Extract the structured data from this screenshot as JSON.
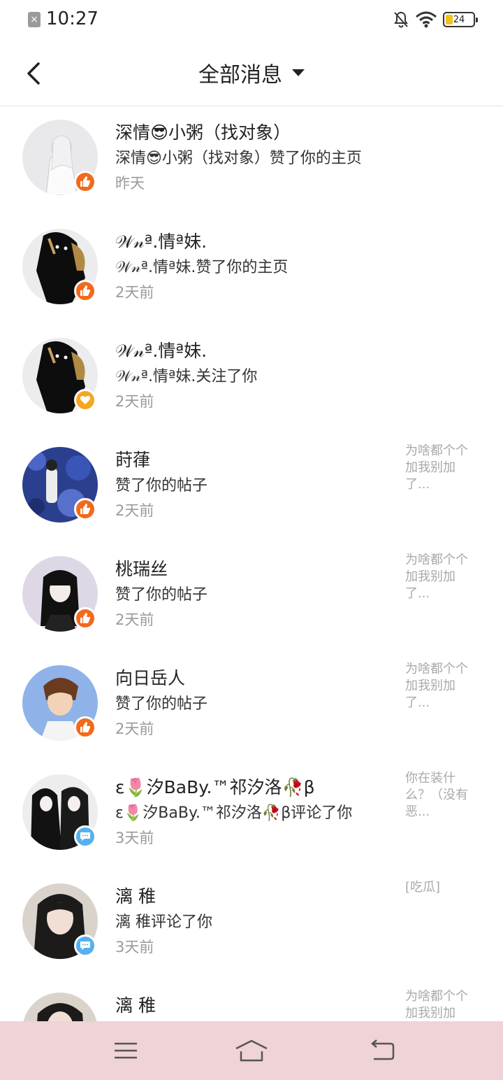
{
  "status_bar": {
    "time": "10:27",
    "battery_level": "24",
    "battery_fraction": 0.24,
    "icons": [
      "notification-icon",
      "mute-icon",
      "wifi-icon",
      "battery-icon"
    ]
  },
  "header": {
    "title": "全部消息"
  },
  "colors": {
    "like_badge": "#f26a1b",
    "follow_badge": "#f5a623",
    "comment_badge": "#56b0f0",
    "nav_bar": "#efd3d6"
  },
  "messages": [
    {
      "name": "深情😎小粥（找对象）",
      "action": "深情😎小粥（找对象）赞了你的主页",
      "time": "昨天",
      "preview": "",
      "badge": "like-icon"
    },
    {
      "name": "𝒲𝓃ª.情ª妹.",
      "action": "𝒲𝓃ª.情ª妹.赞了你的主页",
      "time": "2天前",
      "preview": "",
      "badge": "like-icon"
    },
    {
      "name": "𝒲𝓃ª.情ª妹.",
      "action": "𝒲𝓃ª.情ª妹.关注了你",
      "time": "2天前",
      "preview": "",
      "badge": "heart-icon"
    },
    {
      "name": "莳葎",
      "action": "赞了你的帖子",
      "time": "2天前",
      "preview": "为啥都个个加我别加了...",
      "badge": "like-icon"
    },
    {
      "name": "桃瑞丝",
      "action": "赞了你的帖子",
      "time": "2天前",
      "preview": "为啥都个个加我别加了...",
      "badge": "like-icon"
    },
    {
      "name": "向日岳人",
      "action": "赞了你的帖子",
      "time": "2天前",
      "preview": "为啥都个个加我别加了...",
      "badge": "like-icon"
    },
    {
      "name": "ε🌷汐BaBy.™祁汐洛🥀β",
      "action": "ε🌷汐BaBy.™祁汐洛🥀β评论了你",
      "time": "3天前",
      "preview": "你在装什么？（没有恶...",
      "badge": "comment-icon"
    },
    {
      "name": "漓 稚",
      "action": "漓 稚评论了你",
      "time": "3天前",
      "preview": "[吃瓜]",
      "badge": "comment-icon"
    },
    {
      "name": "漓 稚",
      "action": "",
      "time": "",
      "preview": "为啥都个个加我别加",
      "badge": ""
    }
  ]
}
